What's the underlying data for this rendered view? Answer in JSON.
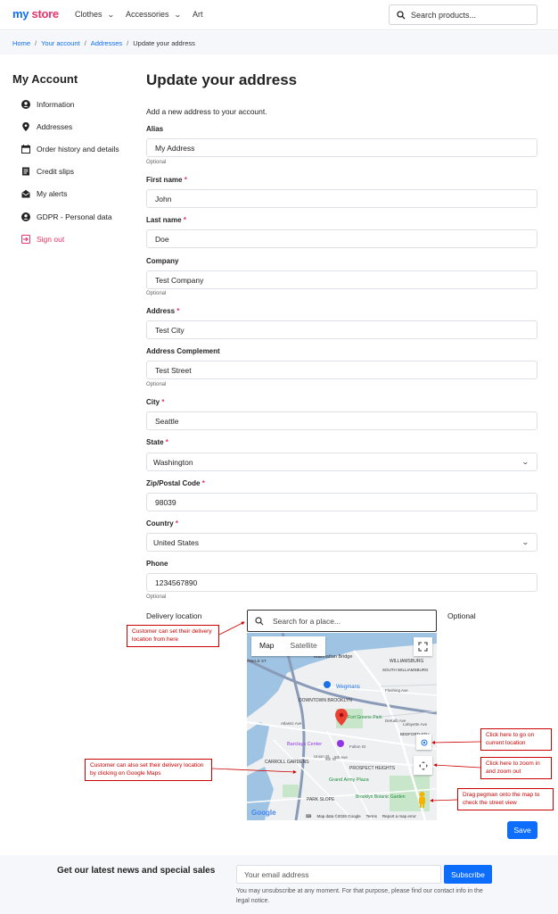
{
  "header": {
    "logo_my": "my",
    "logo_store": "store",
    "nav": [
      "Clothes",
      "Accessories",
      "Art"
    ],
    "search_placeholder": "Search products..."
  },
  "breadcrumb": [
    "Home",
    "Your account",
    "Addresses",
    "Update your address"
  ],
  "sidebar": {
    "title": "My Account",
    "items": [
      {
        "label": "Information",
        "icon": "user-circle-icon"
      },
      {
        "label": "Addresses",
        "icon": "map-pin-icon"
      },
      {
        "label": "Order history and details",
        "icon": "calendar-icon"
      },
      {
        "label": "Credit slips",
        "icon": "receipt-icon"
      },
      {
        "label": "My alerts",
        "icon": "envelope-open-icon"
      },
      {
        "label": "GDPR - Personal data",
        "icon": "user-circle-icon"
      },
      {
        "label": "Sign out",
        "icon": "sign-out-icon"
      }
    ]
  },
  "form": {
    "title": "Update your address",
    "intro": "Add a new address to your account.",
    "optional_text": "Optional",
    "fields": {
      "alias": {
        "label": "Alias",
        "value": "My Address"
      },
      "first_name": {
        "label": "First name",
        "value": "John"
      },
      "last_name": {
        "label": "Last name",
        "value": "Doe"
      },
      "company": {
        "label": "Company",
        "value": "Test Company"
      },
      "address": {
        "label": "Address",
        "value": "Test City"
      },
      "address_complement": {
        "label": "Address Complement",
        "value": "Test Street"
      },
      "city": {
        "label": "City",
        "value": "Seattle"
      },
      "state": {
        "label": "State",
        "value": "Washington"
      },
      "zip": {
        "label": "Zip/Postal Code",
        "value": "98039"
      },
      "country": {
        "label": "Country",
        "value": "United States"
      },
      "phone": {
        "label": "Phone",
        "value": "1234567890"
      }
    },
    "required_mark": "*",
    "delivery_location_label": "Delivery location",
    "delivery_location_optional": "Optional",
    "save_label": "Save"
  },
  "map": {
    "search_placeholder": "Search for a place...",
    "tabs": [
      "Map",
      "Satellite"
    ],
    "places": [
      "Manhattan Bridge",
      "WILLIAMSBURG",
      "SOUTH WILLIAMSBURG",
      "Wegmans",
      "DOWNTOWN BROOKLYN",
      "Flushing Ave",
      "Fort Greene Park",
      "Atlantic Ave",
      "DeKalb Ave",
      "Lafayette Ave",
      "BEDFORD-STU",
      "Barclays Center",
      "Fulton St",
      "CARROLL GARDENS",
      "PROSPECT HEIGHTS",
      "Grand Army Plaza",
      "PARK SLOPE",
      "Brooklyn Botanic Garden",
      "Union St",
      "9th St",
      "5th Ave",
      "ANKLE ST"
    ],
    "google": "Google",
    "footer": [
      "Map data ©2026 Google",
      "Terms",
      "Report a map error"
    ]
  },
  "annotations": {
    "set_location": "Customer can set their delivery location from here",
    "click_map": "Customer can also set their delivery location by clicking on Google Maps",
    "current_location": "Click here to go on current location",
    "zoom": "Click here to zoom in and zoom out",
    "pegman": "Drag pegman onto the map to check the street view"
  },
  "newsletter": {
    "title": "Get our latest news and special sales",
    "placeholder": "Your email address",
    "button": "Subscribe",
    "note": "You may unsubscribe at any moment. For that purpose, please find our contact info in the legal notice."
  },
  "colors": {
    "primary": "#0d6efd",
    "brand_pink": "#e5336b",
    "annotation_red": "#cc0000"
  }
}
